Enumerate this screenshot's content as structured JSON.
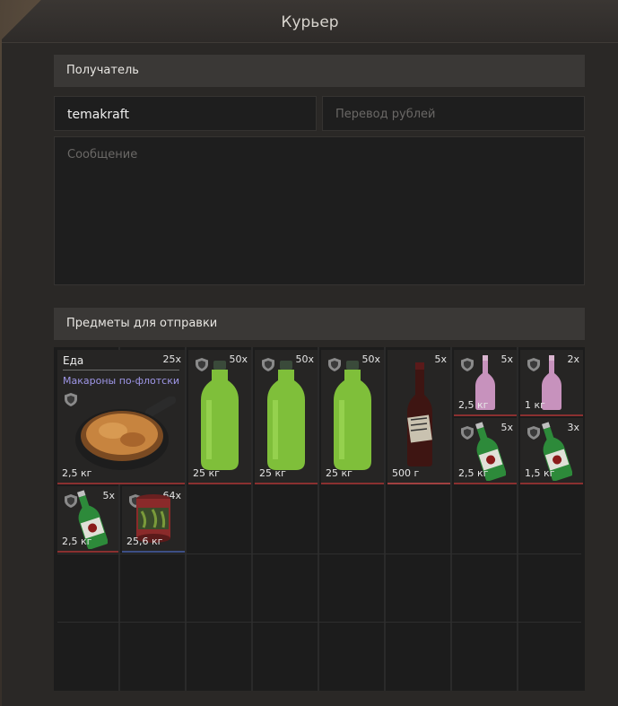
{
  "window": {
    "title": "Курьер"
  },
  "recipient": {
    "header": "Получатель",
    "name_value": "temakraft",
    "money_placeholder": "Перевод рублей",
    "message_placeholder": "Сообщение"
  },
  "items_section": {
    "header": "Предметы для отправки"
  },
  "items": [
    {
      "category": "Еда",
      "name": "Макароны по-флотски",
      "qty": "25x",
      "weight": "2,5 кг",
      "icon": "pasta-pan-icon"
    },
    {
      "qty": "50x",
      "weight": "25 кг",
      "icon": "green-bottle-icon"
    },
    {
      "qty": "50x",
      "weight": "25 кг",
      "icon": "green-bottle-icon"
    },
    {
      "qty": "50x",
      "weight": "25 кг",
      "icon": "green-bottle-icon"
    },
    {
      "qty": "5x",
      "weight": "500 г",
      "icon": "wine-bottle-icon"
    },
    {
      "qty": "5x",
      "weight": "2,5 кг",
      "icon": "pink-bottle-icon"
    },
    {
      "qty": "2x",
      "weight": "1 кг",
      "icon": "pink-bottle-icon"
    },
    {
      "qty": "5x",
      "weight": "2,5 кг",
      "icon": "soda-bottle-icon"
    },
    {
      "qty": "3x",
      "weight": "1,5 кг",
      "icon": "soda-bottle-icon"
    },
    {
      "qty": "5x",
      "weight": "2,5 кг",
      "icon": "soda-bottle-icon"
    },
    {
      "qty": "64x",
      "weight": "25,6 кг",
      "icon": "can-icon"
    }
  ]
}
